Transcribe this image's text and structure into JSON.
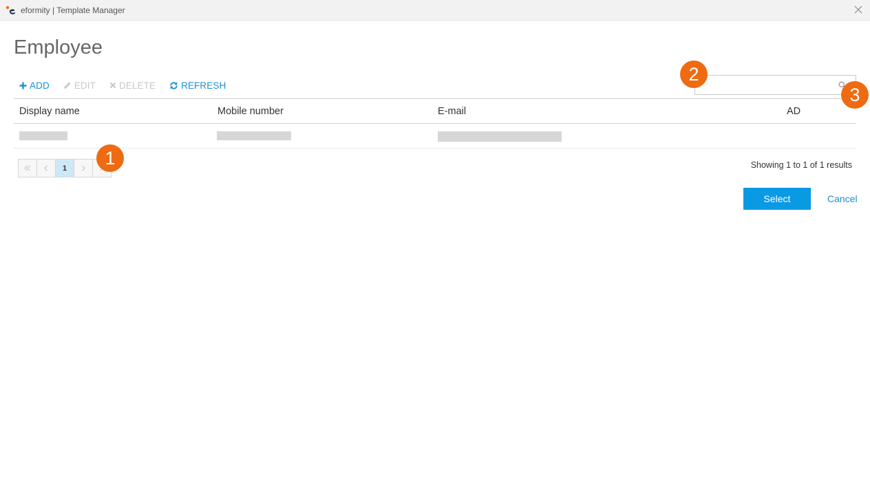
{
  "window": {
    "title": "eformity | Template Manager"
  },
  "page": {
    "title": "Employee"
  },
  "toolbar": {
    "add_label": "ADD",
    "edit_label": "EDIT",
    "delete_label": "DELETE",
    "refresh_label": "REFRESH"
  },
  "search": {
    "value": "",
    "placeholder": ""
  },
  "table": {
    "columns": [
      "Display name",
      "Mobile number",
      "E-mail",
      "AD"
    ]
  },
  "pagination": {
    "current_page": "1",
    "results_text": "Showing 1 to 1 of 1 results"
  },
  "actions": {
    "select_label": "Select",
    "cancel_label": "Cancel"
  },
  "callouts": [
    "1",
    "2",
    "3"
  ],
  "colors": {
    "accent": "#1a8fd0",
    "primary_button": "#0a9ae4",
    "callout": "#ee6b12",
    "disabled": "#c8c8c8"
  }
}
